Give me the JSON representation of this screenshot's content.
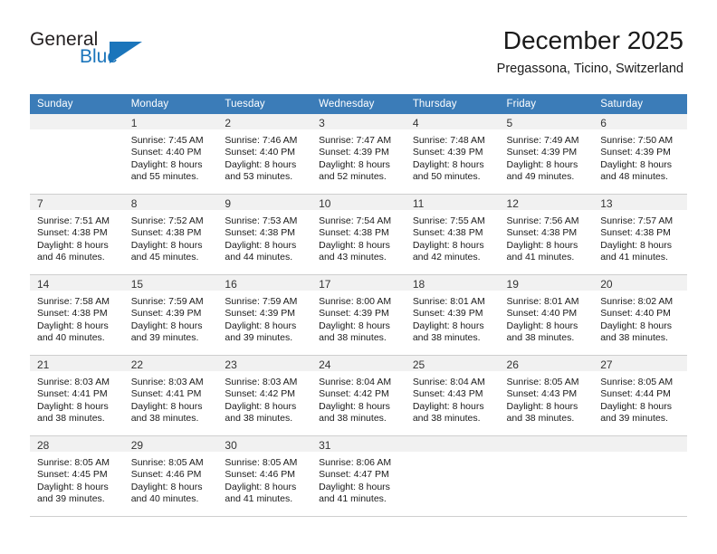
{
  "brand": {
    "name_top": "General",
    "name_bottom": "Blue",
    "accent_color": "#1b75bb"
  },
  "header": {
    "title": "December 2025",
    "subtitle": "Pregassona, Ticino, Switzerland",
    "header_bg_color": "#3b7cb8"
  },
  "weekday_headers": [
    "Sunday",
    "Monday",
    "Tuesday",
    "Wednesday",
    "Thursday",
    "Friday",
    "Saturday"
  ],
  "weeks": [
    [
      {
        "day": "",
        "sunrise": "",
        "sunset": "",
        "daylight_1": "",
        "daylight_2": ""
      },
      {
        "day": "1",
        "sunrise": "Sunrise: 7:45 AM",
        "sunset": "Sunset: 4:40 PM",
        "daylight_1": "Daylight: 8 hours",
        "daylight_2": "and 55 minutes."
      },
      {
        "day": "2",
        "sunrise": "Sunrise: 7:46 AM",
        "sunset": "Sunset: 4:40 PM",
        "daylight_1": "Daylight: 8 hours",
        "daylight_2": "and 53 minutes."
      },
      {
        "day": "3",
        "sunrise": "Sunrise: 7:47 AM",
        "sunset": "Sunset: 4:39 PM",
        "daylight_1": "Daylight: 8 hours",
        "daylight_2": "and 52 minutes."
      },
      {
        "day": "4",
        "sunrise": "Sunrise: 7:48 AM",
        "sunset": "Sunset: 4:39 PM",
        "daylight_1": "Daylight: 8 hours",
        "daylight_2": "and 50 minutes."
      },
      {
        "day": "5",
        "sunrise": "Sunrise: 7:49 AM",
        "sunset": "Sunset: 4:39 PM",
        "daylight_1": "Daylight: 8 hours",
        "daylight_2": "and 49 minutes."
      },
      {
        "day": "6",
        "sunrise": "Sunrise: 7:50 AM",
        "sunset": "Sunset: 4:39 PM",
        "daylight_1": "Daylight: 8 hours",
        "daylight_2": "and 48 minutes."
      }
    ],
    [
      {
        "day": "7",
        "sunrise": "Sunrise: 7:51 AM",
        "sunset": "Sunset: 4:38 PM",
        "daylight_1": "Daylight: 8 hours",
        "daylight_2": "and 46 minutes."
      },
      {
        "day": "8",
        "sunrise": "Sunrise: 7:52 AM",
        "sunset": "Sunset: 4:38 PM",
        "daylight_1": "Daylight: 8 hours",
        "daylight_2": "and 45 minutes."
      },
      {
        "day": "9",
        "sunrise": "Sunrise: 7:53 AM",
        "sunset": "Sunset: 4:38 PM",
        "daylight_1": "Daylight: 8 hours",
        "daylight_2": "and 44 minutes."
      },
      {
        "day": "10",
        "sunrise": "Sunrise: 7:54 AM",
        "sunset": "Sunset: 4:38 PM",
        "daylight_1": "Daylight: 8 hours",
        "daylight_2": "and 43 minutes."
      },
      {
        "day": "11",
        "sunrise": "Sunrise: 7:55 AM",
        "sunset": "Sunset: 4:38 PM",
        "daylight_1": "Daylight: 8 hours",
        "daylight_2": "and 42 minutes."
      },
      {
        "day": "12",
        "sunrise": "Sunrise: 7:56 AM",
        "sunset": "Sunset: 4:38 PM",
        "daylight_1": "Daylight: 8 hours",
        "daylight_2": "and 41 minutes."
      },
      {
        "day": "13",
        "sunrise": "Sunrise: 7:57 AM",
        "sunset": "Sunset: 4:38 PM",
        "daylight_1": "Daylight: 8 hours",
        "daylight_2": "and 41 minutes."
      }
    ],
    [
      {
        "day": "14",
        "sunrise": "Sunrise: 7:58 AM",
        "sunset": "Sunset: 4:38 PM",
        "daylight_1": "Daylight: 8 hours",
        "daylight_2": "and 40 minutes."
      },
      {
        "day": "15",
        "sunrise": "Sunrise: 7:59 AM",
        "sunset": "Sunset: 4:39 PM",
        "daylight_1": "Daylight: 8 hours",
        "daylight_2": "and 39 minutes."
      },
      {
        "day": "16",
        "sunrise": "Sunrise: 7:59 AM",
        "sunset": "Sunset: 4:39 PM",
        "daylight_1": "Daylight: 8 hours",
        "daylight_2": "and 39 minutes."
      },
      {
        "day": "17",
        "sunrise": "Sunrise: 8:00 AM",
        "sunset": "Sunset: 4:39 PM",
        "daylight_1": "Daylight: 8 hours",
        "daylight_2": "and 38 minutes."
      },
      {
        "day": "18",
        "sunrise": "Sunrise: 8:01 AM",
        "sunset": "Sunset: 4:39 PM",
        "daylight_1": "Daylight: 8 hours",
        "daylight_2": "and 38 minutes."
      },
      {
        "day": "19",
        "sunrise": "Sunrise: 8:01 AM",
        "sunset": "Sunset: 4:40 PM",
        "daylight_1": "Daylight: 8 hours",
        "daylight_2": "and 38 minutes."
      },
      {
        "day": "20",
        "sunrise": "Sunrise: 8:02 AM",
        "sunset": "Sunset: 4:40 PM",
        "daylight_1": "Daylight: 8 hours",
        "daylight_2": "and 38 minutes."
      }
    ],
    [
      {
        "day": "21",
        "sunrise": "Sunrise: 8:03 AM",
        "sunset": "Sunset: 4:41 PM",
        "daylight_1": "Daylight: 8 hours",
        "daylight_2": "and 38 minutes."
      },
      {
        "day": "22",
        "sunrise": "Sunrise: 8:03 AM",
        "sunset": "Sunset: 4:41 PM",
        "daylight_1": "Daylight: 8 hours",
        "daylight_2": "and 38 minutes."
      },
      {
        "day": "23",
        "sunrise": "Sunrise: 8:03 AM",
        "sunset": "Sunset: 4:42 PM",
        "daylight_1": "Daylight: 8 hours",
        "daylight_2": "and 38 minutes."
      },
      {
        "day": "24",
        "sunrise": "Sunrise: 8:04 AM",
        "sunset": "Sunset: 4:42 PM",
        "daylight_1": "Daylight: 8 hours",
        "daylight_2": "and 38 minutes."
      },
      {
        "day": "25",
        "sunrise": "Sunrise: 8:04 AM",
        "sunset": "Sunset: 4:43 PM",
        "daylight_1": "Daylight: 8 hours",
        "daylight_2": "and 38 minutes."
      },
      {
        "day": "26",
        "sunrise": "Sunrise: 8:05 AM",
        "sunset": "Sunset: 4:43 PM",
        "daylight_1": "Daylight: 8 hours",
        "daylight_2": "and 38 minutes."
      },
      {
        "day": "27",
        "sunrise": "Sunrise: 8:05 AM",
        "sunset": "Sunset: 4:44 PM",
        "daylight_1": "Daylight: 8 hours",
        "daylight_2": "and 39 minutes."
      }
    ],
    [
      {
        "day": "28",
        "sunrise": "Sunrise: 8:05 AM",
        "sunset": "Sunset: 4:45 PM",
        "daylight_1": "Daylight: 8 hours",
        "daylight_2": "and 39 minutes."
      },
      {
        "day": "29",
        "sunrise": "Sunrise: 8:05 AM",
        "sunset": "Sunset: 4:46 PM",
        "daylight_1": "Daylight: 8 hours",
        "daylight_2": "and 40 minutes."
      },
      {
        "day": "30",
        "sunrise": "Sunrise: 8:05 AM",
        "sunset": "Sunset: 4:46 PM",
        "daylight_1": "Daylight: 8 hours",
        "daylight_2": "and 41 minutes."
      },
      {
        "day": "31",
        "sunrise": "Sunrise: 8:06 AM",
        "sunset": "Sunset: 4:47 PM",
        "daylight_1": "Daylight: 8 hours",
        "daylight_2": "and 41 minutes."
      },
      {
        "day": "",
        "sunrise": "",
        "sunset": "",
        "daylight_1": "",
        "daylight_2": ""
      },
      {
        "day": "",
        "sunrise": "",
        "sunset": "",
        "daylight_1": "",
        "daylight_2": ""
      },
      {
        "day": "",
        "sunrise": "",
        "sunset": "",
        "daylight_1": "",
        "daylight_2": ""
      }
    ]
  ]
}
